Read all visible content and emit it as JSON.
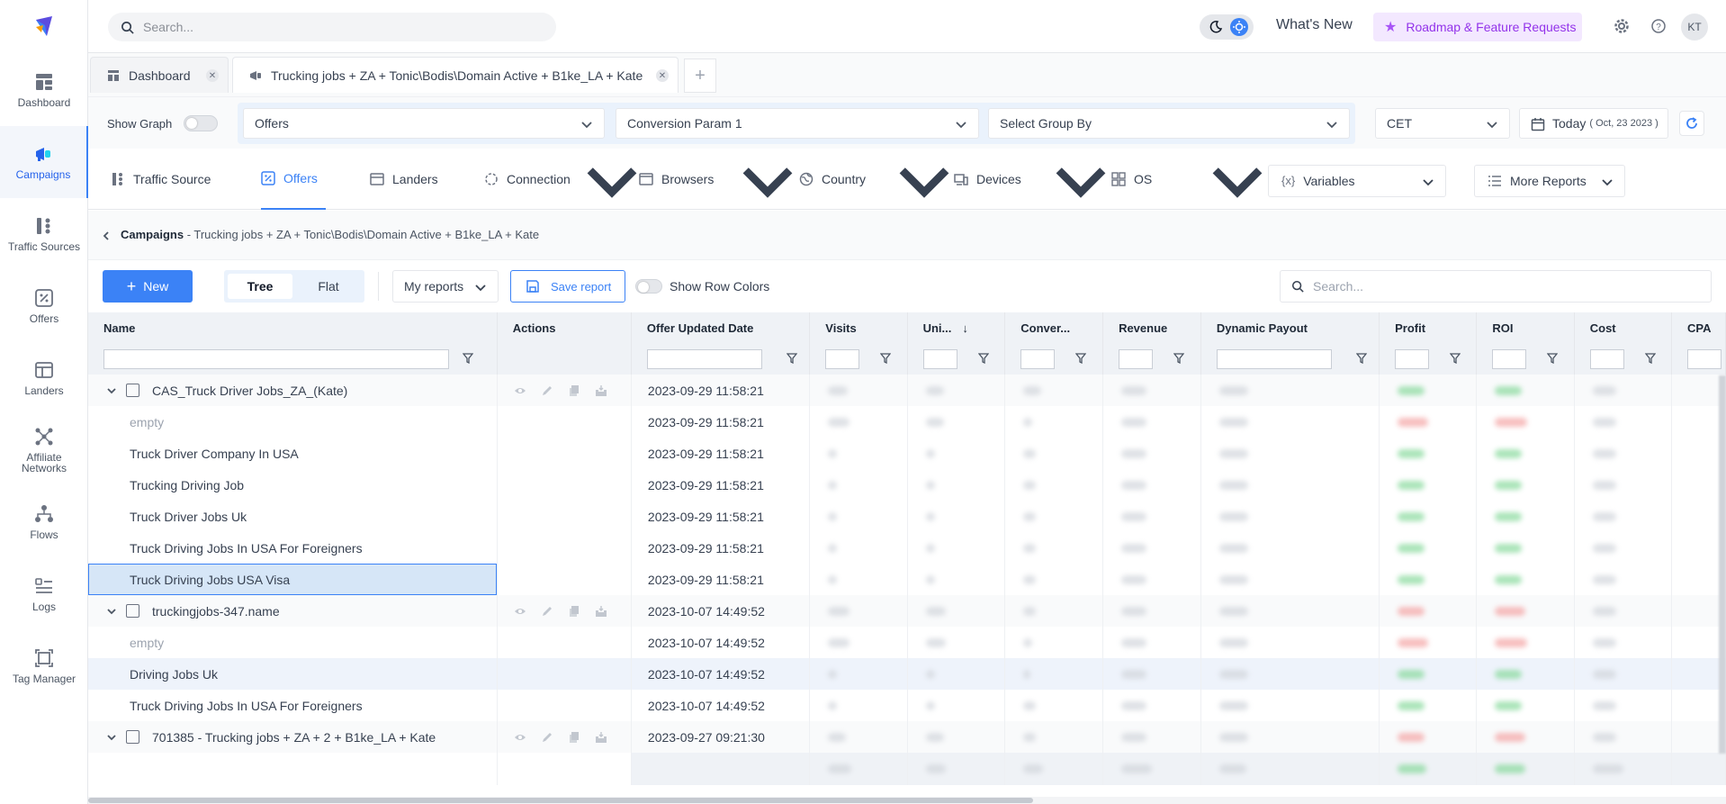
{
  "app": {
    "search_placeholder": "Search...",
    "whats_new": "What's New",
    "roadmap": "Roadmap & Feature Requests",
    "avatar_initials": "KT",
    "accent_color": "#3b82f6"
  },
  "sidebar": {
    "items": [
      {
        "label": "Dashboard",
        "icon": "dashboard-icon"
      },
      {
        "label": "Campaigns",
        "icon": "megaphone-icon"
      },
      {
        "label": "Traffic Sources",
        "icon": "traffic-sources-icon"
      },
      {
        "label": "Offers",
        "icon": "percent-icon"
      },
      {
        "label": "Landers",
        "icon": "landers-icon"
      },
      {
        "label": "Affiliate Networks",
        "icon": "network-icon"
      },
      {
        "label": "Flows",
        "icon": "flows-icon"
      },
      {
        "label": "Logs",
        "icon": "logs-icon"
      },
      {
        "label": "Tag Manager",
        "icon": "tag-manager-icon"
      }
    ]
  },
  "tabs": {
    "dashboard": "Dashboard",
    "campaign": "Trucking jobs + ZA + Tonic\\Bodis\\Domain Active + B1ke_LA + Kate",
    "add": "+"
  },
  "filters": {
    "show_graph": "Show Graph",
    "group1": "Offers",
    "group2": "Conversion Param 1",
    "group3": "Select Group By",
    "timezone": "CET",
    "date_label": "Today",
    "date_value": "( Oct, 23 2023 )"
  },
  "reports": {
    "traffic_source": "Traffic Source",
    "offers": "Offers",
    "landers": "Landers",
    "connection": "Connection",
    "browsers": "Browsers",
    "country": "Country",
    "devices": "Devices",
    "os": "OS",
    "variables": "Variables",
    "more_reports": "More Reports"
  },
  "breadcrumb": {
    "root": "Campaigns",
    "path": " - Trucking jobs + ZA + Tonic\\Bodis\\Domain Active + B1ke_LA + Kate"
  },
  "toolbar": {
    "new": "New",
    "tree": "Tree",
    "flat": "Flat",
    "my_reports": "My reports",
    "save_report": "Save report",
    "show_row_colors": "Show Row Colors",
    "search_placeholder": "Search..."
  },
  "table": {
    "columns": [
      "Name",
      "Actions",
      "Offer Updated Date",
      "Visits",
      "Uni...",
      "Conver...",
      "Revenue",
      "Dynamic Payout",
      "Profit",
      "ROI",
      "Cost",
      "CPA"
    ],
    "rows": [
      {
        "name": "CAS_Truck Driver Jobs_ZA_(Kate)",
        "date": "2023-09-29 11:58:21"
      },
      {
        "name": "empty",
        "date": "2023-09-29 11:58:21"
      },
      {
        "name": "Truck Driver Company In USA",
        "date": "2023-09-29 11:58:21"
      },
      {
        "name": "Trucking Driving Job",
        "date": "2023-09-29 11:58:21"
      },
      {
        "name": "Truck Driver Jobs Uk",
        "date": "2023-09-29 11:58:21"
      },
      {
        "name": "Truck Driving Jobs In USA For Foreigners",
        "date": "2023-09-29 11:58:21"
      },
      {
        "name": "Truck Driving Jobs USA Visa",
        "date": "2023-09-29 11:58:21"
      },
      {
        "name": "truckingjobs-347.name",
        "date": "2023-10-07 14:49:52"
      },
      {
        "name": "empty",
        "date": "2023-10-07 14:49:52"
      },
      {
        "name": "Driving Jobs Uk",
        "date": "2023-10-07 14:49:52"
      },
      {
        "name": "Truck Driving Jobs In USA For Foreigners",
        "date": "2023-10-07 14:49:52"
      },
      {
        "name": "701385 - Trucking jobs + ZA + 2 + B1ke_LA + Kate",
        "date": "2023-09-27 09:21:30"
      }
    ]
  }
}
